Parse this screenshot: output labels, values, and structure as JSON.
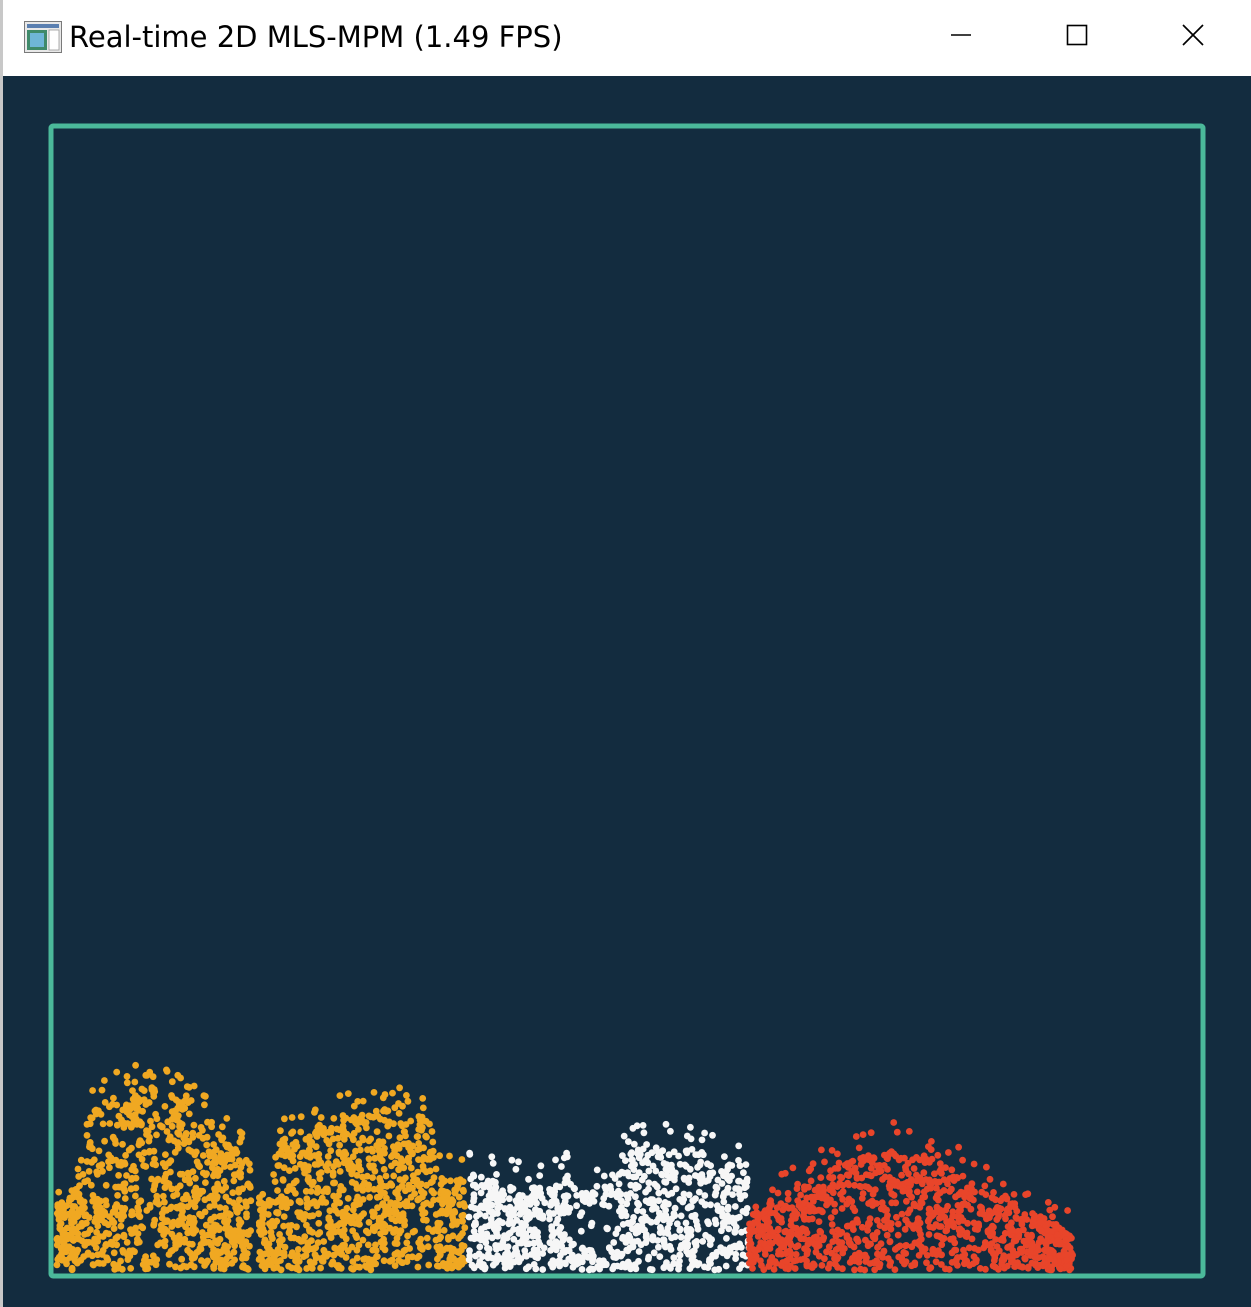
{
  "window": {
    "title": "Real-time 2D MLS-MPM (1.49 FPS)",
    "icon": "app-window-icon",
    "controls": {
      "minimize_icon": "minimize-icon",
      "maximize_icon": "maximize-icon",
      "close_icon": "close-icon"
    }
  },
  "simulation": {
    "background_color": "#132c3f",
    "boundary_color": "#4bb99a",
    "materials": [
      {
        "name": "jelly-block-1",
        "color": "#f0a822"
      },
      {
        "name": "jelly-block-2",
        "color": "#f0a822"
      },
      {
        "name": "snow-block",
        "color": "#f6f6f6"
      },
      {
        "name": "fluid-block",
        "color": "#e8452a"
      }
    ]
  }
}
